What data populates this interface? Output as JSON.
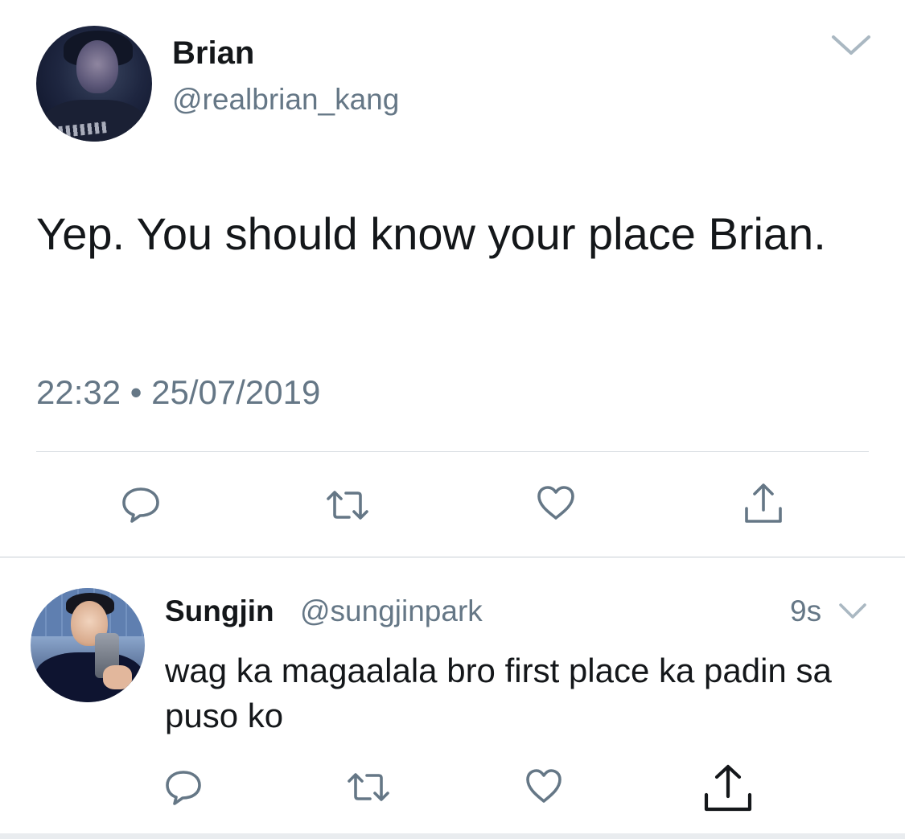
{
  "main_tweet": {
    "display_name": "Brian",
    "handle": "@realbrian_kang",
    "text": "Yep. You should know your place Brian.",
    "timestamp": "22:32 • 25/07/2019",
    "icons": {
      "menu": "chevron-down-icon",
      "reply": "reply-icon",
      "retweet": "retweet-icon",
      "like": "heart-icon",
      "share": "share-icon"
    }
  },
  "reply_tweet": {
    "display_name": "Sungjin",
    "handle": "@sungjinpark",
    "relative_time": "9s",
    "text": "wag ka magaalala bro first place ka padin sa puso ko",
    "icons": {
      "menu": "chevron-down-icon",
      "reply": "reply-icon",
      "retweet": "retweet-icon",
      "like": "heart-icon",
      "share": "share-icon"
    }
  },
  "colors": {
    "text_primary": "#14171a",
    "text_secondary": "#657786",
    "icon": "#657786",
    "divider": "#d6dbe0"
  }
}
